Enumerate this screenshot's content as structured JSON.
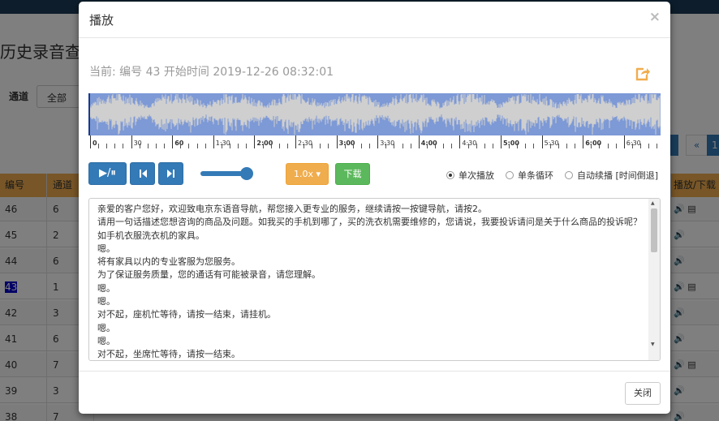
{
  "background": {
    "page_title": "历史录音查",
    "channel_label": "通道",
    "channel_value": "全部",
    "pager": {
      "prev": "«",
      "current": "1"
    },
    "table": {
      "headers": {
        "id": "编号",
        "channel": "通道",
        "ops": "播放/下载"
      },
      "rows": [
        {
          "id": "46",
          "channel": "6",
          "ops": "🔊 ▤"
        },
        {
          "id": "45",
          "channel": "2",
          "ops": "🔊"
        },
        {
          "id": "44",
          "channel": "6",
          "ops": "🔊"
        },
        {
          "id": "43",
          "channel": "1",
          "ops": "🔊 ▤"
        },
        {
          "id": "42",
          "channel": "3",
          "ops": "🔊"
        },
        {
          "id": "41",
          "channel": "6",
          "ops": "🔊"
        },
        {
          "id": "40",
          "channel": "7",
          "ops": "🔊 ▤"
        },
        {
          "id": "39",
          "channel": "3",
          "ops": "🔊"
        },
        {
          "id": "38",
          "channel": "7",
          "ops": "🔊"
        }
      ]
    }
  },
  "modal": {
    "title": "播放",
    "close_x": "×",
    "current_info": "当前: 编号 43 开始时间 2019-12-26 08:32:01",
    "timeline_ticks": [
      "0",
      "30",
      "60",
      "1:30",
      "2:00",
      "2:30",
      "3:00",
      "3:30",
      "4:00",
      "4:30",
      "5:00",
      "5:30",
      "6:00",
      "6:30"
    ],
    "controls": {
      "play_pause": "▶/⏸",
      "prev": "⏮",
      "next": "⏭",
      "speed": "1.0x ▾",
      "download": "下载",
      "volume_level": 0.85
    },
    "play_modes": [
      {
        "label": "单次播放",
        "selected": true
      },
      {
        "label": "单条循环",
        "selected": false
      },
      {
        "label": "自动续播 [时间倒退]",
        "selected": false
      }
    ],
    "transcript": [
      "亲爱的客户您好，欢迎致电京东语音导航，帮您接入更专业的服务，继续请按一按键导航，请按2。",
      "请用一句话描述您想咨询的商品及问题。如我买的手机到哪了，买的洗衣机需要维修的，您请说，我要投诉请问是关于什么商品的投诉呢？如手机衣服洗衣机的家具。",
      "嗯。",
      "将有家具以内的专业客服为您服务。",
      "为了保证服务质量，您的通话有可能被录音，请您理解。",
      "嗯。",
      "嗯。",
      "对不起，座机忙等待，请按一结束，请挂机。",
      "嗯。",
      "嗯。",
      "对不起，坐席忙等待，请按一结束。"
    ],
    "footer": {
      "close_label": "关闭"
    },
    "colors": {
      "primary": "#337ab7",
      "warning": "#f0ad4e",
      "success": "#5cb85c",
      "waveform_bg": "#7d99d6",
      "waveform_fg": "#cfcfcf",
      "export_icon": "#f0ad4e"
    }
  }
}
